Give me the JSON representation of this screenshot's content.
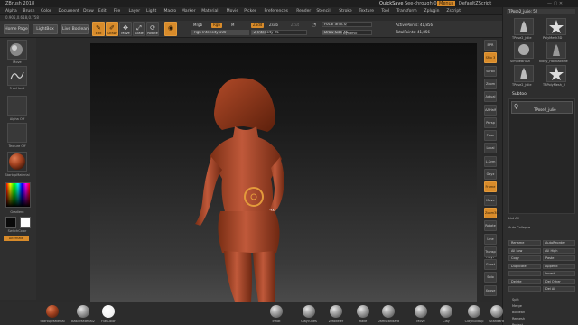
{
  "title_bar": {
    "app_title": "ZBrush 2018",
    "quicksave": "QuickSave",
    "see_through": "See-through 0",
    "menus_label": "Menus",
    "default_script": "DefaultZScript"
  },
  "menu": [
    "Alpha",
    "Brush",
    "Color",
    "Document",
    "Draw",
    "Edit",
    "File",
    "Layer",
    "Light",
    "Macro",
    "Marker",
    "Material",
    "Movie",
    "Picker",
    "Preferences",
    "Render",
    "Stencil",
    "Stroke",
    "Texture",
    "Tool",
    "Transform",
    "Zplugin",
    "Zscript"
  ],
  "info_line": "0.905,0.618,0.758",
  "toolbar": {
    "home_page": "Home Page",
    "lightbox": "LightBox",
    "live_boolean": "Live Boolean",
    "edit": "Edit",
    "draw": "Draw",
    "move": "Move",
    "scale": "Scale",
    "rotate": "Rotate",
    "mrgb": "Mrgb",
    "rgb": "Rgb",
    "m": "M",
    "zadd": "Zadd",
    "zsub": "Zsub",
    "zcut": "Zcut",
    "rgb_intensity": "Rgb Intensity 100",
    "z_intensity": "Z Intensity 25",
    "focal_shift": "Focal Shift 0",
    "draw_size": "Draw Size 46",
    "dynamic": "Dynamic",
    "active_points": "ActivePoints: 41,856",
    "total_points": "TotalPoints: 41,856"
  },
  "left_panel": {
    "brush_label": "Move",
    "stroke_label": "FreeHand",
    "alpha_label": "Alpha Off",
    "texture_label": "Texture Off",
    "material_label": "StartupMaterial",
    "gradient_label": "Gradient",
    "switch_label": "SwitchColor",
    "alternate_label": "Alternate"
  },
  "right_shelf": [
    "BPR",
    "SPix 3",
    "Scroll",
    "Zoom",
    "Actual",
    "AAHalf",
    "Persp",
    "Floor",
    "Local",
    "L.Sym",
    "Gxyz",
    "Frame",
    "Move",
    "Zoom3D",
    "Rotate",
    "Line Fill PolyF",
    "Transp",
    "Ghost",
    "Solo",
    "Xpose"
  ],
  "tray": {
    "tool_name": "TPose2_julie: 52",
    "tools": [
      "TPose2_julie",
      "PolyMesh3D",
      "SimpleBrush",
      "Nicky_HalfbackMe",
      "TPose2_julie",
      "TBPolyMesh_3"
    ],
    "subtool_header": "Subtool",
    "subtool_item": "TPose2_julie",
    "list_all": "List All",
    "auto_collapse": "Auto Collapse",
    "rows": [
      [
        "Rename",
        "AutoReorder"
      ],
      [
        "All Low",
        "All High"
      ],
      [
        "Copy",
        "Paste"
      ],
      [
        "Duplicate",
        "Append"
      ],
      [
        "",
        "Insert"
      ],
      [
        "Delete",
        "Del Other"
      ],
      [
        "",
        "Del All"
      ]
    ],
    "actions": [
      "Split",
      "Merge",
      "Boolean",
      "Remesh",
      "Project"
    ]
  },
  "bottom_shelf": [
    "StartupMaterial",
    "BasicMaterial2",
    "FlatColor",
    "Inflat",
    "ClayTubes",
    "ZModeler",
    "Rake",
    "DamStandard",
    "Move",
    "Clay",
    "ClayBuildup",
    "Standard"
  ],
  "colors": {
    "accent": "#d88b2a",
    "viewport_top": "#0f0f0f",
    "skin": "#b8532f"
  }
}
